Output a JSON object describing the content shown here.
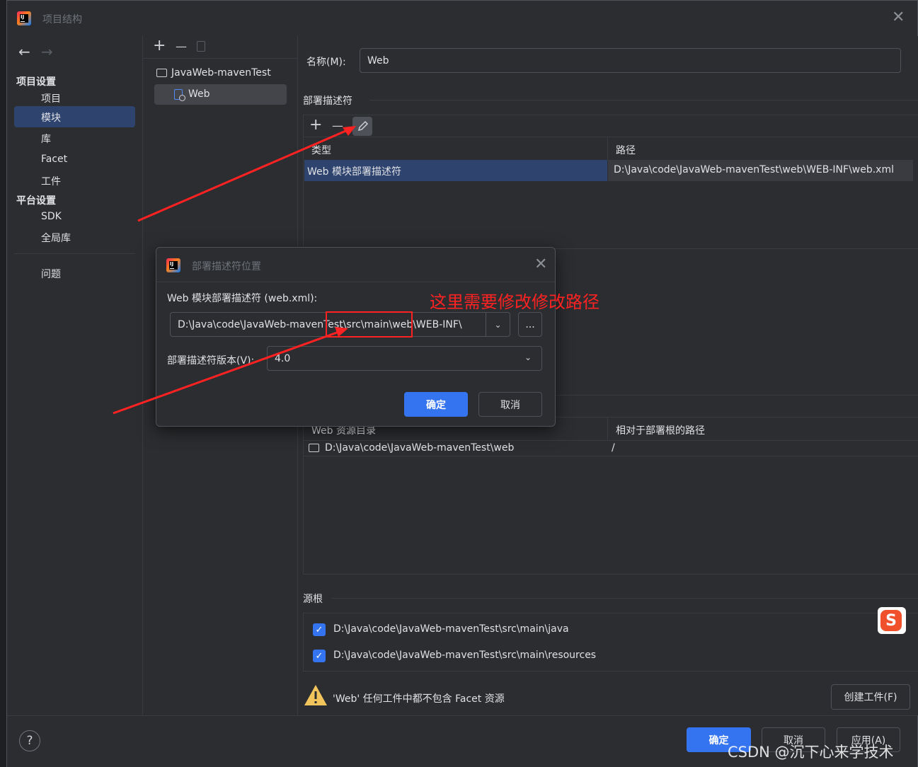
{
  "window": {
    "title": "项目结构"
  },
  "nav": {
    "back": "←",
    "forward": "→",
    "section_project": "项目设置",
    "items_project": [
      "项目",
      "模块",
      "库",
      "Facet",
      "工件"
    ],
    "section_platform": "平台设置",
    "items_platform": [
      "SDK",
      "全局库"
    ],
    "problems": "问题"
  },
  "modules": {
    "add": "+",
    "remove": "—",
    "tree": [
      {
        "label": "JavaWeb-mavenTest"
      },
      {
        "label": "Web"
      }
    ]
  },
  "facet": {
    "name_label": "名称(M):",
    "name_value": "Web",
    "deployment_title": "部署描述符",
    "columns": [
      "类型",
      "路径"
    ],
    "rows": [
      {
        "type": "Web 模块部署描述符",
        "path": "D:\\Java\\code\\JavaWeb-mavenTest\\web\\WEB-INF\\web.xml"
      }
    ],
    "resources_columns": [
      "Web 资源目录",
      "相对于部署根的路径"
    ],
    "resources_rows": [
      {
        "dir": "D:\\Java\\code\\JavaWeb-mavenTest\\web",
        "rel": "/"
      }
    ],
    "source_roots_title": "源根",
    "source_roots": [
      "D:\\Java\\code\\JavaWeb-mavenTest\\src\\main\\java",
      "D:\\Java\\code\\JavaWeb-mavenTest\\src\\main\\resources"
    ],
    "warning": "'Web' 任何工件中都不包含 Facet 资源",
    "create_artifact": "创建工件(F)"
  },
  "dialog": {
    "title": "部署描述符位置",
    "field_label": "Web 模块部署描述符 (web.xml):",
    "path_value": "D:\\Java\\code\\JavaWeb-mavenTest\\src\\main\\web\\WEB-INF\\",
    "browse": "...",
    "version_label": "部署描述符版本(V):",
    "version_value": "4.0",
    "ok": "确定",
    "cancel": "取消"
  },
  "annotation": {
    "text": "这里需要修改修改路径",
    "color": "#ff2222"
  },
  "footer": {
    "help": "?",
    "ok": "确定",
    "cancel": "取消",
    "apply": "应用(A)",
    "watermark": "CSDN @沉下心来学技术"
  },
  "colors": {
    "accent": "#3574f0",
    "selection": "#2e436e",
    "background": "#2b2d30",
    "annotation": "#ff2222"
  }
}
